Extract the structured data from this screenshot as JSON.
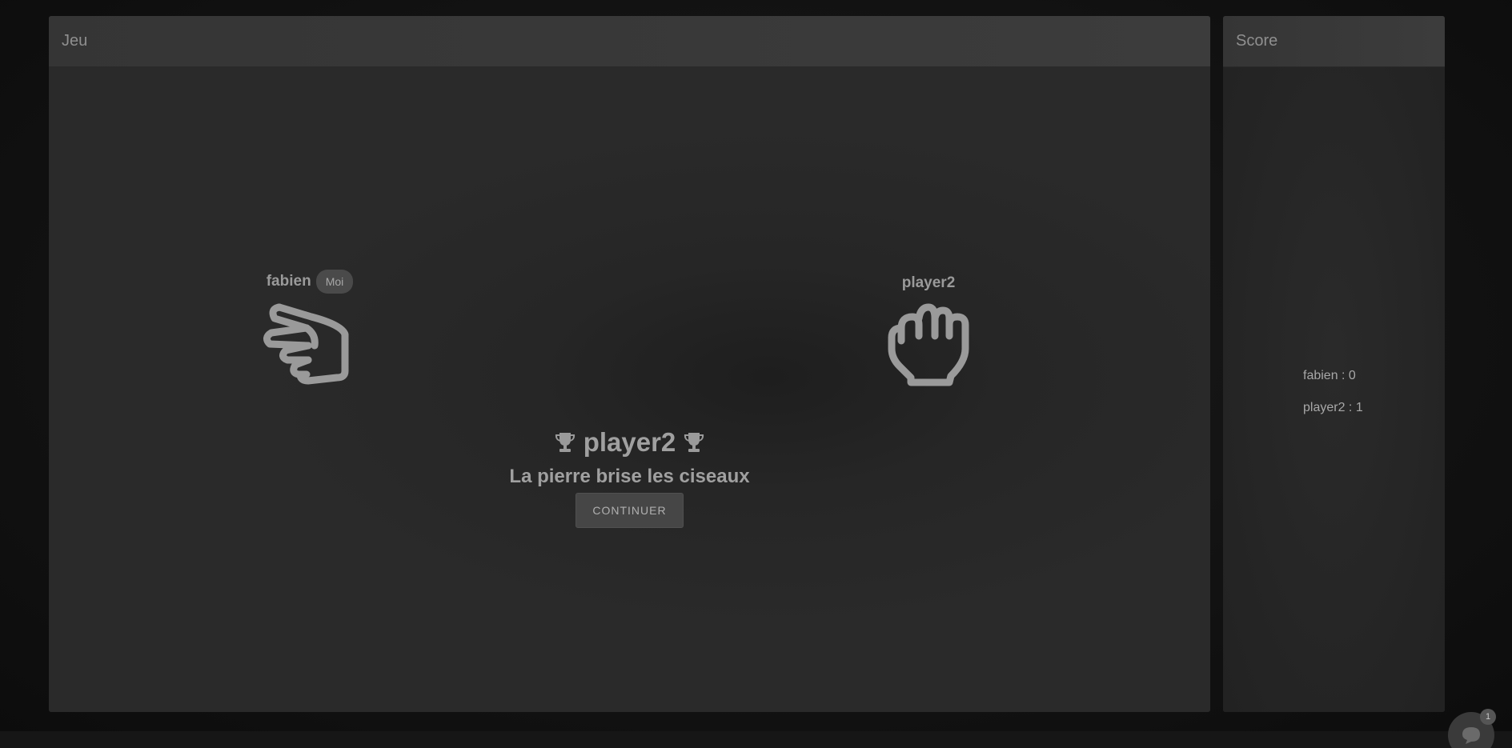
{
  "game_panel": {
    "title": "Jeu"
  },
  "score_panel": {
    "title": "Score"
  },
  "players": {
    "left": {
      "name": "fabien",
      "badge": "Moi",
      "choice": "scissors"
    },
    "right": {
      "name": "player2",
      "choice": "rock"
    }
  },
  "result": {
    "winner": "player2",
    "message": "La pierre brise les ciseaux",
    "continue_label": "CONTINUER"
  },
  "scores": [
    {
      "label": "fabien : 0"
    },
    {
      "label": "player2 : 1"
    }
  ],
  "chat": {
    "unread_count": "1"
  },
  "colors": {
    "background": "#111111",
    "panel": "#282828",
    "header": "#3a3a3a",
    "text": "#9a9a9a",
    "button": "#464646"
  }
}
